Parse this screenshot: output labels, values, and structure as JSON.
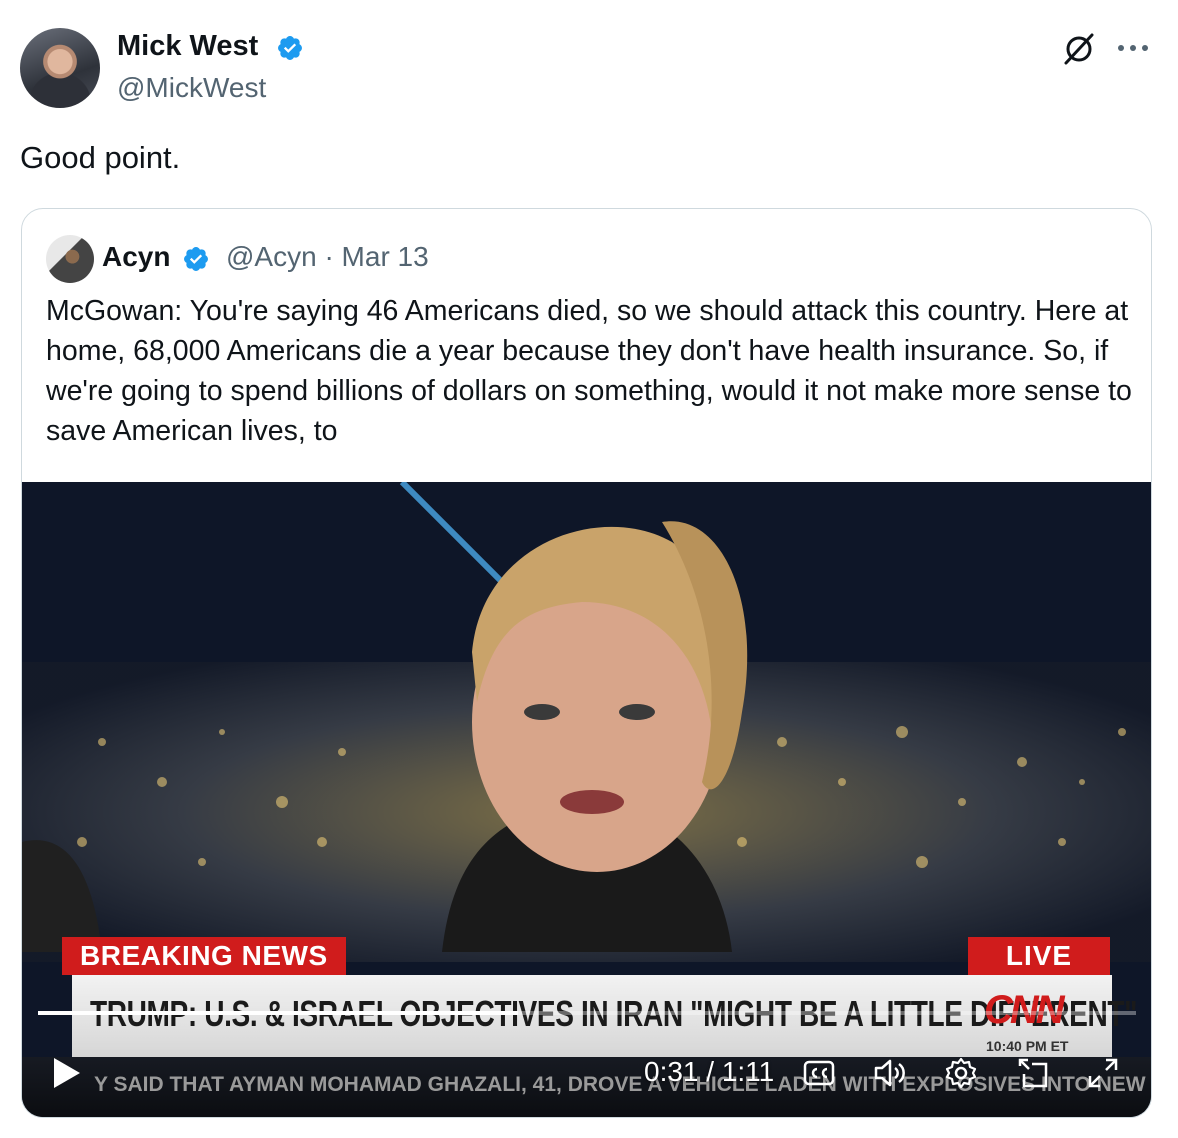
{
  "tweet": {
    "author_name": "Mick West",
    "author_handle": "@MickWest",
    "text": "Good point."
  },
  "quoted_tweet": {
    "author_name": "Acyn",
    "author_handle": "@Acyn",
    "date": "· Mar 13",
    "text": "McGowan: You're saying 46 Americans died, so we should attack this country. Here at home, 68,000 Americans die a year because they don't have health insurance. So, if we're going to spend billions of dollars on something, would it not make more sense to save American lives, to"
  },
  "video": {
    "chyron_label": "BREAKING NEWS",
    "live_label": "LIVE",
    "headline": "TRUMP: U.S. & ISRAEL OBJECTIVES IN IRAN \"MIGHT BE A LITTLE DIFFERENT\"",
    "network_logo": "CNN",
    "broadcast_time": "10:40 PM ET",
    "ticker": "Y SAID THAT AYMAN MOHAMAD GHAZALI, 41, DROVE A VEHICLE LADEN WITH EXPLOSIVES INTO NEW LIGHT",
    "current_time": "0:31",
    "duration": "1:11",
    "time_display": "0:31 / 1:11",
    "progress_fraction": 0.437
  },
  "icons": {
    "verified": "verified-badge-icon",
    "grok": "grok-icon",
    "more": "more-icon",
    "play": "play-icon",
    "captions": "captions-icon",
    "volume": "volume-icon",
    "settings": "gear-icon",
    "pip": "picture-in-picture-icon",
    "fullscreen": "fullscreen-icon"
  },
  "colors": {
    "verified_blue": "#1d9bf0",
    "text_primary": "#0f1419",
    "text_secondary": "#536471",
    "border": "#cfd9de",
    "cnn_red": "#d01c1c"
  }
}
